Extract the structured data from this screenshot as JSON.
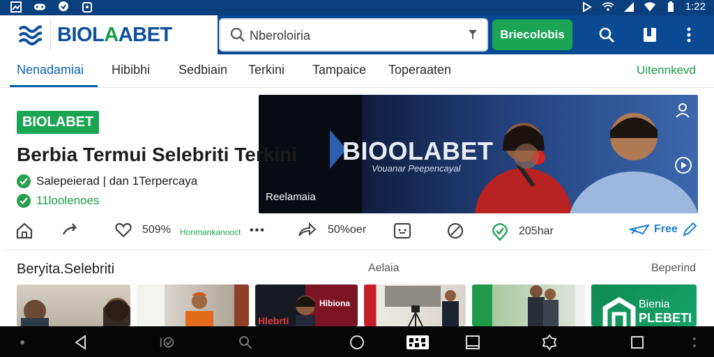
{
  "status_bar": {
    "time": "1:22"
  },
  "app_bar": {
    "logo_text_blue": "BIOL",
    "logo_text_green": "A",
    "logo_text_blue2": "ABET",
    "search_value": "Nbero­loiria",
    "green_button_label": "Briecolobis"
  },
  "tabs": {
    "items": [
      "Nenadamiai",
      "Hibibhi",
      "Sedbiain",
      "Terkini",
      "Tampaice",
      "Toperaaten"
    ],
    "right_label": "Uitennkevd"
  },
  "hero": {
    "badge": "BIOLABET",
    "title": "Berbia Termui Selebriti Terkini",
    "check1": "Salepeierad  | dan 1Terpercaya",
    "check2": "11loolenoes",
    "banner_logo": "BIOOLABET",
    "banner_sub": "Vouanar Peepencayal",
    "banner_caption": "Reelamaia"
  },
  "actions": {
    "like_count": "509%",
    "share_small": "Honmankanooct",
    "more": "•••",
    "forward_count": "50%oer",
    "verified_count": "205har",
    "free_label": "Free"
  },
  "section": {
    "title": "Beryita.Selebriti",
    "mid": "Aelaia",
    "right": "Beperind"
  },
  "thumbnails": {
    "t3_label_top": "Hibiona",
    "t3_label_bottom": "Hlebrti",
    "t6_label_top": "Bienia",
    "t6_label_bottom": "PLEBETI"
  },
  "colors": {
    "brand_blue": "#0a4a93",
    "brand_green": "#1aa454",
    "tab_active": "#0b5fb0"
  }
}
